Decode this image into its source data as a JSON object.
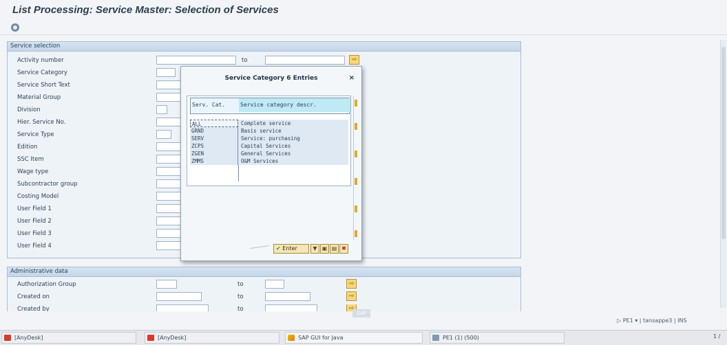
{
  "window": {
    "title": "List Processing: Service Master: Selection of Services"
  },
  "service_selection": {
    "header": "Service selection",
    "fields": [
      {
        "label": "Activity number",
        "to_label": "to"
      },
      {
        "label": "Service Category"
      },
      {
        "label": "Service Short Text"
      },
      {
        "label": "Material Group"
      },
      {
        "label": "Division"
      },
      {
        "label": "Hier. Service No."
      },
      {
        "label": "Service Type"
      },
      {
        "label": "Edition"
      },
      {
        "label": "SSC Item"
      },
      {
        "label": "Wage type"
      },
      {
        "label": "Subcontractor group"
      },
      {
        "label": "Costing Model"
      },
      {
        "label": "User Field 1"
      },
      {
        "label": "User Field 2"
      },
      {
        "label": "User Field 3"
      },
      {
        "label": "User Field 4"
      }
    ]
  },
  "administrative_data": {
    "header": "Administrative data",
    "fields": [
      {
        "label": "Authorization Group",
        "to_label": "to"
      },
      {
        "label": "Created on",
        "to_label": "to"
      },
      {
        "label": "Created by",
        "to_label": "to"
      }
    ]
  },
  "popup": {
    "title": "Service Category 6 Entries",
    "close": "×",
    "columns": [
      "Serv. Cat.",
      "Service category descr."
    ],
    "rows": [
      [
        "ALL",
        "Complete service"
      ],
      [
        "GRND",
        "Basis service"
      ],
      [
        "SERV",
        "Service: purchasing"
      ],
      [
        "ZCPS",
        "Capital Services"
      ],
      [
        "ZGEN",
        "General Services"
      ],
      [
        "ZMMS",
        "O&M Services"
      ]
    ],
    "enter_label": "Enter"
  },
  "status": {
    "system": "PE1",
    "server": "tansappe3",
    "mode": "INS",
    "sap_logo": "SAP"
  },
  "taskbar": {
    "items": [
      "[AnyDesk]",
      "[AnyDesk]",
      "SAP GUI for Java",
      "PE1 (1) (500)"
    ],
    "page": "1 /"
  }
}
